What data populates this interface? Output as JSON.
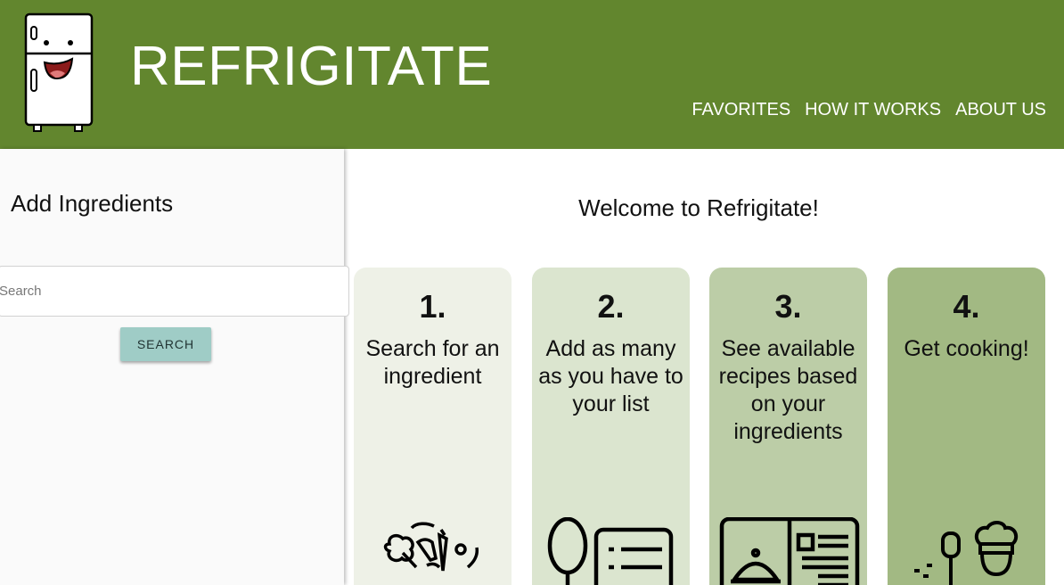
{
  "header": {
    "brand": "REFRIGITATE",
    "nav": [
      "FAVORITES",
      "HOW IT WORKS",
      "ABOUT US"
    ],
    "color": "#62862e"
  },
  "sidebar": {
    "title": "Add Ingredients",
    "search_placeholder": "Search",
    "search_button": "SEARCH"
  },
  "main": {
    "welcome": "Welcome to Refrigitate!",
    "steps": [
      {
        "number": "1.",
        "text": "Search for an ingredient",
        "color": "#eef1e7",
        "icon": "vegetables-icon"
      },
      {
        "number": "2.",
        "text": "Add as many as you have to your list",
        "color": "#dbe5cf",
        "icon": "spoon-list-icon"
      },
      {
        "number": "3.",
        "text": "See available recipes based on your ingredients",
        "color": "#bccda7",
        "icon": "recipe-book-icon"
      },
      {
        "number": "4.",
        "text": "Get cooking!",
        "color": "#a2b983",
        "icon": "chef-icon"
      }
    ]
  }
}
